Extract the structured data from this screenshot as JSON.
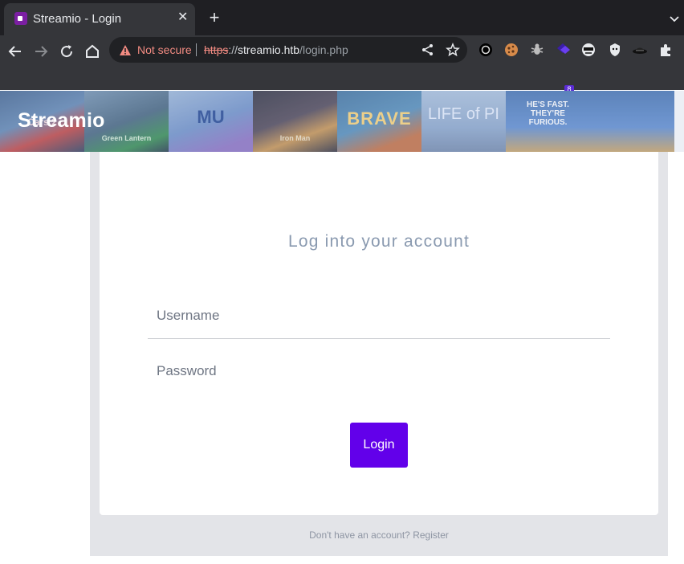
{
  "browser": {
    "tab_title": "Streamio - Login",
    "tab_close": "✕",
    "new_tab": "+",
    "security_label": "Not secure",
    "url_scheme": "https",
    "url_sep": "://",
    "url_host": "streamio.htb",
    "url_path": "/login.php",
    "extension_badge": "8"
  },
  "hero": {
    "brand": "Streamio",
    "posters": [
      "Cars 2",
      "Green Lantern",
      "MU",
      "Iron Man",
      "BRAVE",
      "LIFE of PI",
      "HE'S FAST. THEY'RE FURIOUS."
    ]
  },
  "login": {
    "title": "Log into your account",
    "username_placeholder": "Username",
    "password_placeholder": "Password",
    "button": "Login"
  },
  "footer": {
    "prompt": "Don't have an account?",
    "register_link": "Register"
  }
}
